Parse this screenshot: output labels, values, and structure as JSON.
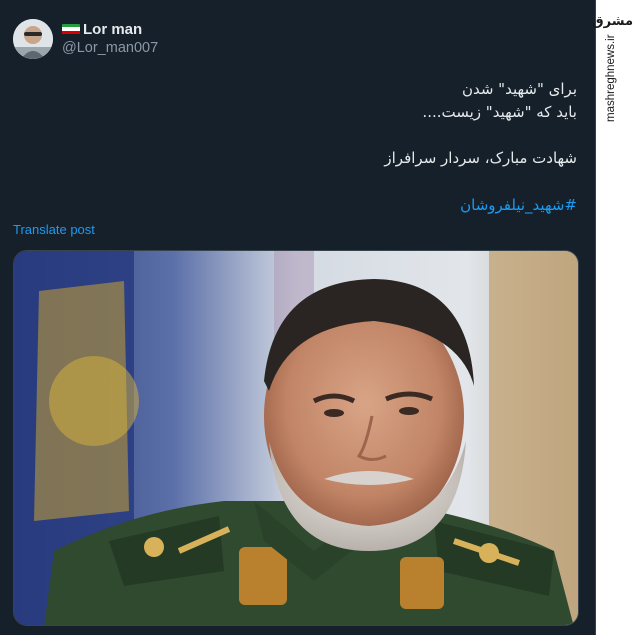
{
  "tweet": {
    "display_name": "Lor man",
    "handle": "@Lor_man007",
    "avatar_icon": "user-avatar-icon",
    "flag_icon": "iran-flag-icon",
    "text_lines": [
      "برای \"شهید\" شدن",
      "باید که \"شهید\" زیست....",
      "",
      "شهادت مبارک، سردار سرافراز"
    ],
    "hashtag": "#شهید_نیلفروشان",
    "translate_label": "Translate post",
    "media_icon": "portrait-photo-icon"
  },
  "watermark": {
    "logo": "مشرق",
    "url": "mashreghnews.ir"
  },
  "colors": {
    "background": "#15202b",
    "text": "#e7e9ea",
    "secondary": "#8b98a5",
    "link": "#1d9bf0",
    "border": "#38444d"
  }
}
